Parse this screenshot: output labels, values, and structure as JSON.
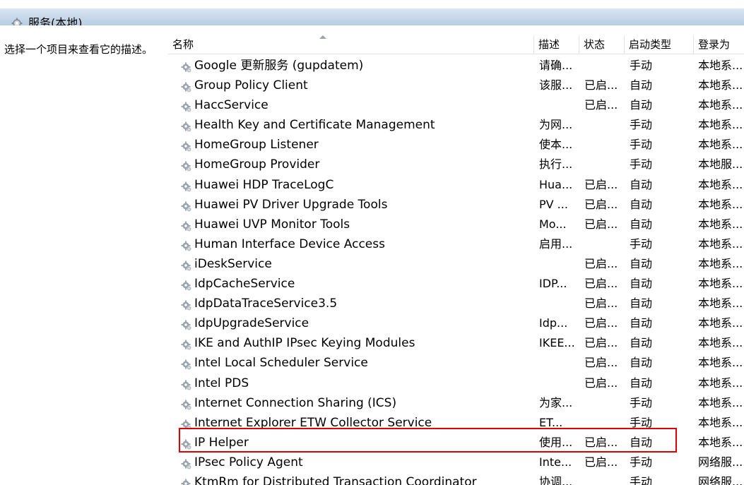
{
  "window": {
    "title": "服务(本地)",
    "title_icon": "services-icon"
  },
  "description_panel": {
    "text": "选择一个项目来查看它的描述。"
  },
  "columns": [
    {
      "key": "name",
      "label": "名称"
    },
    {
      "key": "desc",
      "label": "描述"
    },
    {
      "key": "status",
      "label": "状态"
    },
    {
      "key": "startup",
      "label": "启动类型"
    },
    {
      "key": "logon",
      "label": "登录为"
    }
  ],
  "services": [
    {
      "name": "Google 更新服务 (gupdatem)",
      "desc": "请确...",
      "status": "",
      "startup": "手动",
      "logon": "本地系..."
    },
    {
      "name": "Group Policy Client",
      "desc": "该服...",
      "status": "已启...",
      "startup": "自动",
      "logon": "本地系..."
    },
    {
      "name": "HaccService",
      "desc": "",
      "status": "已启...",
      "startup": "自动",
      "logon": "本地系..."
    },
    {
      "name": "Health Key and Certificate Management",
      "desc": "为网...",
      "status": "",
      "startup": "手动",
      "logon": "本地系..."
    },
    {
      "name": "HomeGroup Listener",
      "desc": "使本...",
      "status": "",
      "startup": "手动",
      "logon": "本地系..."
    },
    {
      "name": "HomeGroup Provider",
      "desc": "执行...",
      "status": "",
      "startup": "手动",
      "logon": "本地服..."
    },
    {
      "name": "Huawei HDP TraceLogC",
      "desc": "Hua...",
      "status": "已启...",
      "startup": "自动",
      "logon": "本地系..."
    },
    {
      "name": "Huawei PV Driver Upgrade Tools",
      "desc": "PV ...",
      "status": "已启...",
      "startup": "自动",
      "logon": "本地系..."
    },
    {
      "name": "Huawei UVP Monitor Tools",
      "desc": "Mo...",
      "status": "已启...",
      "startup": "自动",
      "logon": "本地系..."
    },
    {
      "name": "Human Interface Device Access",
      "desc": "启用...",
      "status": "",
      "startup": "手动",
      "logon": "本地系..."
    },
    {
      "name": "iDeskService",
      "desc": "",
      "status": "已启...",
      "startup": "自动",
      "logon": "本地系..."
    },
    {
      "name": "IdpCacheService",
      "desc": "IDP...",
      "status": "已启...",
      "startup": "自动",
      "logon": "本地系..."
    },
    {
      "name": "IdpDataTraceService3.5",
      "desc": "",
      "status": "已启...",
      "startup": "自动",
      "logon": "本地系..."
    },
    {
      "name": "IdpUpgradeService",
      "desc": "Idp...",
      "status": "已启...",
      "startup": "自动",
      "logon": "本地系..."
    },
    {
      "name": "IKE and AuthIP IPsec Keying Modules",
      "desc": "IKEE...",
      "status": "已启...",
      "startup": "自动",
      "logon": "本地系..."
    },
    {
      "name": "Intel Local Scheduler Service",
      "desc": "",
      "status": "已启...",
      "startup": "自动",
      "logon": "本地系..."
    },
    {
      "name": "Intel PDS",
      "desc": "",
      "status": "已启...",
      "startup": "自动",
      "logon": "本地系..."
    },
    {
      "name": "Internet Connection Sharing (ICS)",
      "desc": "为家...",
      "status": "",
      "startup": "手动",
      "logon": "本地系..."
    },
    {
      "name": "Internet Explorer ETW Collector Service",
      "desc": "ET...",
      "status": "",
      "startup": "手动",
      "logon": "本地系..."
    },
    {
      "name": "IP Helper",
      "desc": "使用...",
      "status": "已启...",
      "startup": "自动",
      "logon": "本地系..."
    },
    {
      "name": "IPsec Policy Agent",
      "desc": "Inte...",
      "status": "已启...",
      "startup": "手动",
      "logon": "网络服..."
    },
    {
      "name": "KtmRm for Distributed Transaction Coordinator",
      "desc": "协调...",
      "status": "",
      "startup": "手动",
      "logon": "网络服..."
    }
  ],
  "highlighted_service": "IP Helper",
  "colors": {
    "highlight_border": "#e00000",
    "titlebar": "#b8cde2",
    "gear": "#9aa4ae"
  }
}
